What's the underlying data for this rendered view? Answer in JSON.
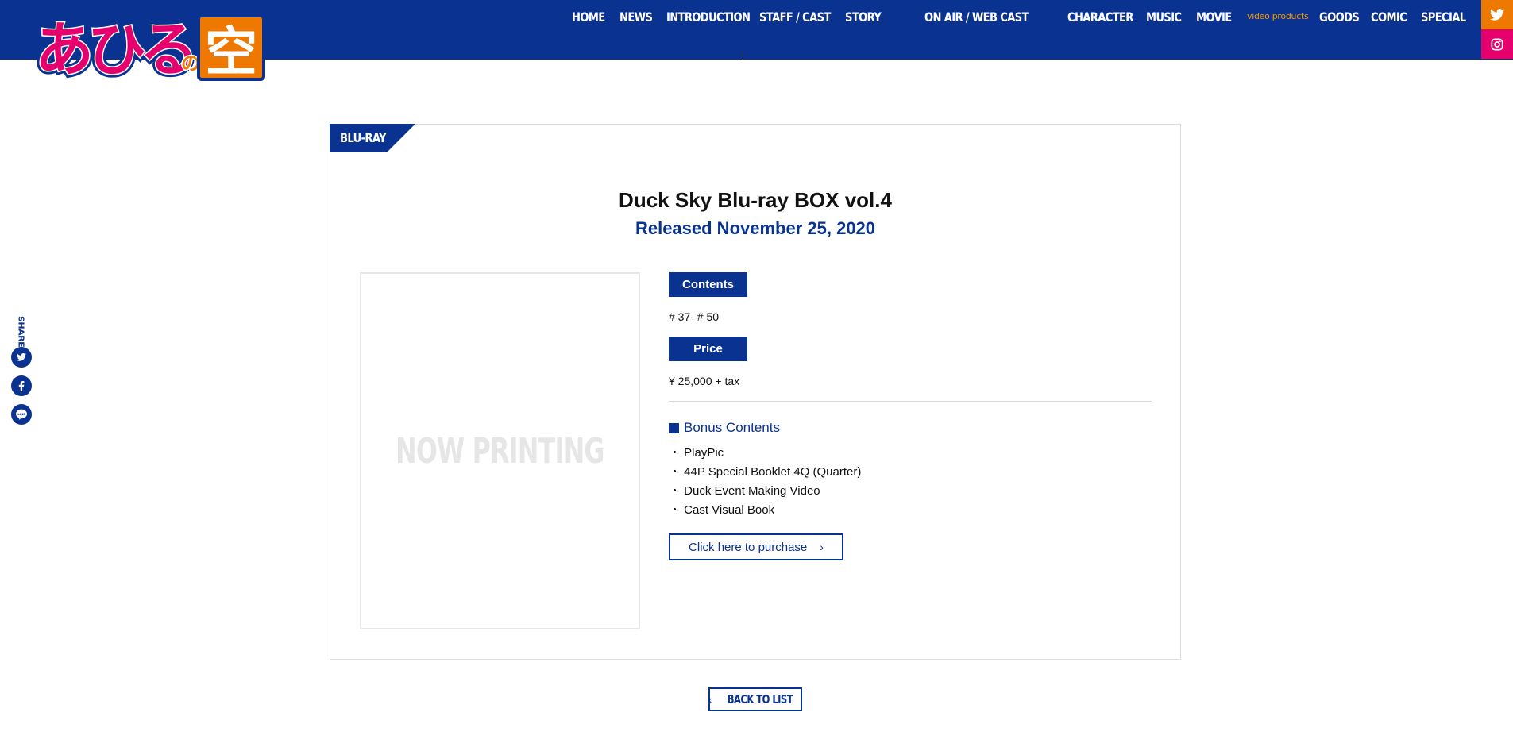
{
  "logo": {
    "text_a": "あひる",
    "text_b": "の",
    "text_c": "空"
  },
  "nav": {
    "items": [
      "HOME",
      "NEWS",
      "INTRODUCTION",
      "STAFF / CAST",
      "STORY",
      "ON AIR / WEB CAST",
      "CHARACTER",
      "MUSIC",
      "MOVIE",
      "video products",
      "GOODS",
      "COMIC",
      "SPECIAL"
    ],
    "active": "video products",
    "accent_color": "#f39800"
  },
  "social_top": {
    "twitter": "twitter-icon",
    "instagram": "instagram-icon"
  },
  "share": {
    "label": "SHARE",
    "buttons": [
      "twitter-icon",
      "facebook-icon",
      "line-icon"
    ]
  },
  "product": {
    "category": "BLU-RAY",
    "title": "Duck Sky Blu-ray BOX vol.4",
    "release": "Released November 25, 2020",
    "jacket_placeholder": "NOW PRINTING",
    "contents_label": "Contents",
    "contents_value": "# 37- # 50",
    "price_label": "Price",
    "price_value": "¥ 25,000 + tax",
    "bonus_title": "Bonus Contents",
    "bonus_items": [
      "・ PlayPic",
      "・ 44P Special Booklet 4Q (Quarter)",
      "・ Duck Event Making Video",
      "・ Cast Visual Book"
    ],
    "purchase_label": "Click here to purchase"
  },
  "back_label": "BACK TO LIST",
  "colors": {
    "brand_blue": "#0a3291",
    "orange": "#ee7800",
    "pink": "#e5006e"
  }
}
